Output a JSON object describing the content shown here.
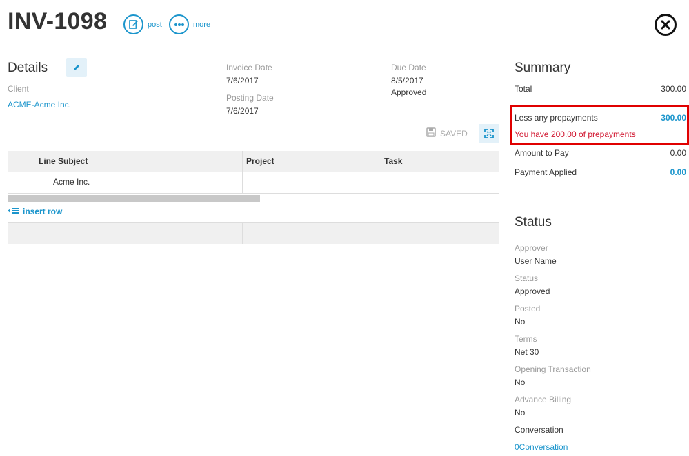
{
  "header": {
    "invoice_number": "INV-1098",
    "post_label": "post",
    "more_label": "more"
  },
  "details": {
    "title": "Details",
    "client_label": "Client",
    "client_value": "ACME-Acme Inc.",
    "invoice_date_label": "Invoice Date",
    "invoice_date": "7/6/2017",
    "posting_date_label": "Posting Date",
    "posting_date": "7/6/2017",
    "due_date_label": "Due Date",
    "due_date": "8/5/2017",
    "approval_status": "Approved"
  },
  "lines": {
    "saved_label": "SAVED",
    "columns": [
      "Line Subject",
      "Project",
      "Task"
    ],
    "rows": [
      {
        "line_subject": "Acme Inc.",
        "project": "",
        "task": ""
      }
    ],
    "insert_row_label": "insert row"
  },
  "summary": {
    "title": "Summary",
    "total_label": "Total",
    "total_value": "300.00",
    "prepayments_label": "Less any prepayments",
    "prepayments_value": "300.00",
    "prepayments_note": "You have 200.00 of prepayments",
    "amount_to_pay_label": "Amount to Pay",
    "amount_to_pay_value": "0.00",
    "payment_applied_label": "Payment Applied",
    "payment_applied_value": "0.00",
    "highlight_color": "#e00000"
  },
  "status": {
    "title": "Status",
    "approver_label": "Approver",
    "approver_value": "User Name",
    "status_label": "Status",
    "status_value": "Approved",
    "posted_label": "Posted",
    "posted_value": "No",
    "terms_label": "Terms",
    "terms_value": "Net 30",
    "opening_label": "Opening Transaction",
    "opening_value": "No",
    "advance_label": "Advance Billing",
    "advance_value": "No",
    "conversation_label": "Conversation",
    "conversation_value": "0Conversation"
  },
  "colors": {
    "accent": "#1b95cc",
    "alert": "#d0112b"
  },
  "icons": [
    "edit-note-icon",
    "ellipsis-icon",
    "close-icon",
    "pencil-icon",
    "save-disk-icon",
    "expand-icon",
    "insert-row-icon"
  ]
}
